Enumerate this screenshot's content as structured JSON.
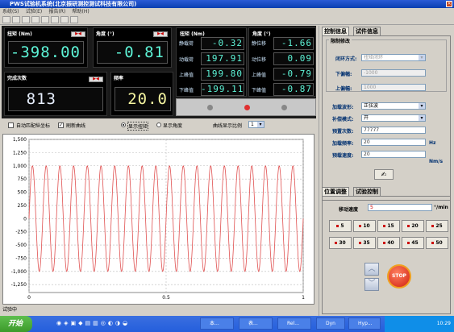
{
  "window": {
    "title": "PWS试验机系统(北京振研测控测试科技有限公司)"
  },
  "menu": [
    "系统(S)",
    "试验(E)",
    "报告(R)",
    "帮助(H)"
  ],
  "panels": {
    "torque": {
      "label": "扭矩 (Nm)",
      "value": "-398.00",
      "reset": "▶◀"
    },
    "angle": {
      "label": "角度 (°)",
      "value": "-0.81",
      "reset": "▶◀"
    },
    "count": {
      "label": "完成次数",
      "value": "813",
      "reset": "▶◀"
    },
    "freq": {
      "label": "频率",
      "value": "20.0"
    },
    "peak_torque": {
      "label": "扭矩 (Nm)",
      "rows": [
        {
          "label": "静载荷",
          "value": "-0.32"
        },
        {
          "label": "动载荷",
          "value": "197.91"
        },
        {
          "label": "上峰值",
          "value": "199.80"
        },
        {
          "label": "下峰值",
          "value": "-199.11"
        }
      ]
    },
    "peak_angle": {
      "label": "角度 (°)",
      "rows": [
        {
          "label": "静位移",
          "value": "-1.66"
        },
        {
          "label": "动位移",
          "value": "0.09"
        },
        {
          "label": "上峰值",
          "value": "-0.79"
        },
        {
          "label": "下峰值",
          "value": "-0.87"
        }
      ]
    }
  },
  "options": {
    "auto_match": "自动匹配纵坐标",
    "refresh": "刷新曲线",
    "show_torque": "显示扭矩",
    "show_angle": "显示角度",
    "scale_label": "曲线显示比例",
    "scale_value": "1"
  },
  "chart_data": {
    "type": "line",
    "yticks": [
      "1,500",
      "1,250",
      "1,000",
      "750",
      "500",
      "250",
      "0",
      "-250",
      "-500",
      "-750",
      "-1,000",
      "-1,250"
    ],
    "xticks": [
      "0",
      "0.5",
      "1"
    ],
    "ylim": [
      -1400,
      1500
    ],
    "xlim": [
      0,
      1
    ],
    "series": [
      {
        "amplitude": 1000,
        "cycles": 20,
        "color": "#e05050"
      }
    ],
    "grid": true
  },
  "status": "试验中",
  "right": {
    "tabs": [
      "控制信息",
      "试件信息"
    ],
    "group1": "限制修改",
    "loop_label": "闭环方式:",
    "loop_value": "扭矩闭环",
    "upper_label": "上偏幅:",
    "upper_value": "1000",
    "lower_label": "下偏幅:",
    "lower_value": "-1000",
    "wave_label": "加载波形:",
    "wave_value": "正弦波",
    "comp_label": "补偿模式:",
    "comp_value": "开",
    "preset_label": "预置次数:",
    "preset_value": "77777",
    "freq_label": "加载频率:",
    "freq_value": "20",
    "freq_unit": "Hz",
    "speed_label": "预载速度:",
    "speed_value": "20",
    "speed_unit": "Nm/s",
    "tabs2": [
      "位置调整",
      "试验控制"
    ],
    "move_label": "移动速度",
    "move_value": "5",
    "move_unit": "°/min",
    "speed_buttons": [
      "5",
      "10",
      "15",
      "20",
      "25",
      "30",
      "35",
      "40",
      "45",
      "50"
    ],
    "stop": "STOP"
  },
  "taskbar": {
    "start": "开始",
    "tasks": [
      "本...",
      "表...",
      "Rel...",
      "Dyn",
      "Hyp...",
      ""
    ],
    "time": "10:29"
  }
}
